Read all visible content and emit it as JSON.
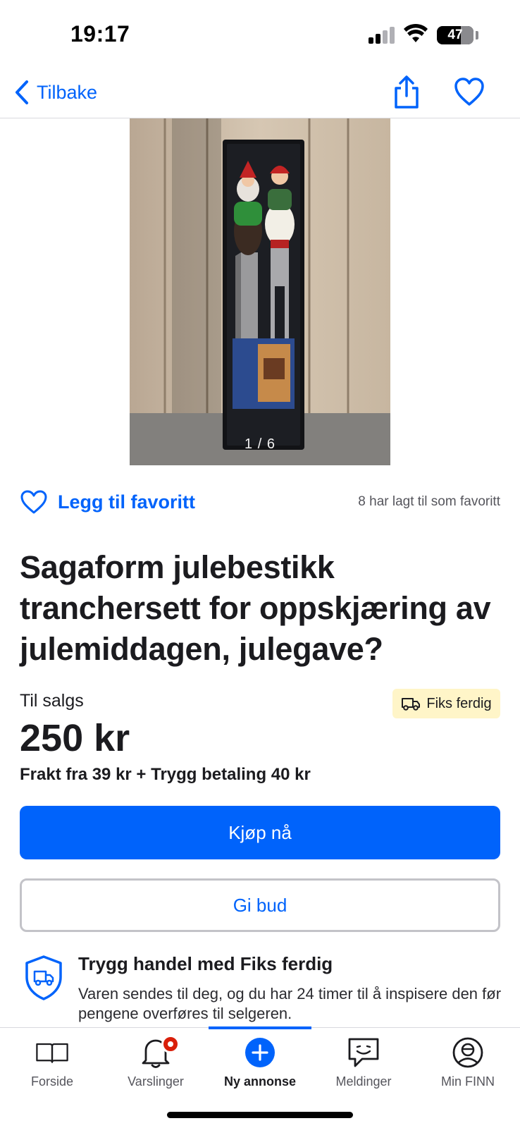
{
  "status_bar": {
    "time": "19:17",
    "battery": "47"
  },
  "nav": {
    "back_label": "Tilbake",
    "share_icon": "share-icon",
    "favorite_icon": "heart-icon"
  },
  "gallery": {
    "counter": "1 / 6"
  },
  "favorite": {
    "add_label": "Legg til favoritt",
    "count_text": "8 har lagt til som favoritt"
  },
  "listing": {
    "title": "Sagaform julebestikk tranchersett for oppskjæring av julemiddagen, julegave?",
    "sale_type": "Til salgs",
    "badge": "Fiks ferdig",
    "price": "250 kr",
    "shipping": "Frakt fra 39 kr + Trygg betaling 40 kr"
  },
  "actions": {
    "buy_label": "Kjøp nå",
    "bid_label": "Gi bud"
  },
  "safe_trade": {
    "title": "Trygg handel med Fiks ferdig",
    "text": "Varen sendes til deg, og du har 24 timer til å inspisere den før pengene overføres til selgeren."
  },
  "tabs": [
    {
      "label": "Forside",
      "icon": "book-icon"
    },
    {
      "label": "Varslinger",
      "icon": "bell-icon"
    },
    {
      "label": "Ny annonse",
      "icon": "plus-circle-icon"
    },
    {
      "label": "Meldinger",
      "icon": "chat-icon"
    },
    {
      "label": "Min FINN",
      "icon": "profile-icon"
    }
  ],
  "colors": {
    "accent": "#0063fb",
    "badge_bg": "#fff5c8",
    "notification": "#d91f0a"
  }
}
